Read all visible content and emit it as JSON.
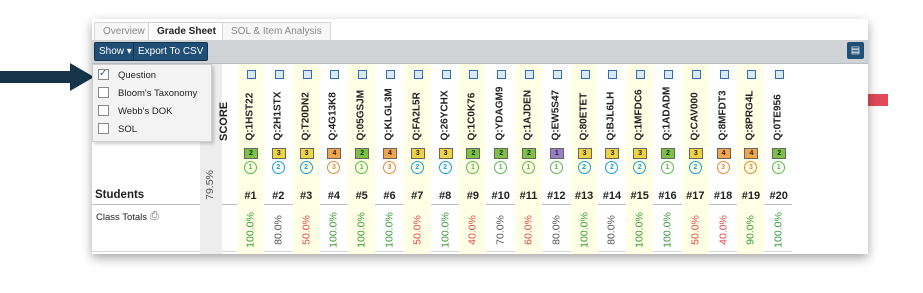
{
  "tabs": [
    "Overview",
    "Grade Sheet",
    "SOL & Item Analysis"
  ],
  "toolbar": {
    "show_label": "Show ▾",
    "export_label": "Export To CSV"
  },
  "show_menu": [
    {
      "label": "Question",
      "checked": true
    },
    {
      "label": "Bloom's Taxonomy",
      "checked": false
    },
    {
      "label": "Webb's DOK",
      "checked": false
    },
    {
      "label": "SOL",
      "checked": false
    }
  ],
  "grid": {
    "students_header": "Students",
    "score_header": "SCORE",
    "class_totals_label": "Class Totals",
    "class_score": "79.5%"
  },
  "questions": [
    {
      "id": "Q:1HST22",
      "num": "#1",
      "bloom": "2",
      "bloom_color": "#7cc242",
      "dok": "1",
      "dok_color": "#58b947",
      "pct": "100.0%",
      "pct_color": "#3a9a3a"
    },
    {
      "id": "Q:2H1STX",
      "num": "#2",
      "bloom": "3",
      "bloom_color": "#f0d343",
      "dok": "2",
      "dok_color": "#1a9ed8",
      "pct": "80.0%",
      "pct_color": "#555555"
    },
    {
      "id": "Q:T20DN2",
      "num": "#3",
      "bloom": "3",
      "bloom_color": "#f0d343",
      "dok": "2",
      "dok_color": "#1a9ed8",
      "pct": "50.0%",
      "pct_color": "#e24a4a"
    },
    {
      "id": "Q:4G13K8",
      "num": "#4",
      "bloom": "4",
      "bloom_color": "#f2a54a",
      "dok": "3",
      "dok_color": "#e38a2f",
      "pct": "100.0%",
      "pct_color": "#3a9a3a"
    },
    {
      "id": "Q:05GSJM",
      "num": "#5",
      "bloom": "2",
      "bloom_color": "#7cc242",
      "dok": "1",
      "dok_color": "#58b947",
      "pct": "100.0%",
      "pct_color": "#3a9a3a"
    },
    {
      "id": "Q:KLGL3M",
      "num": "#6",
      "bloom": "4",
      "bloom_color": "#f2a54a",
      "dok": "3",
      "dok_color": "#e38a2f",
      "pct": "100.0%",
      "pct_color": "#3a9a3a"
    },
    {
      "id": "Q:FA2L5R",
      "num": "#7",
      "bloom": "3",
      "bloom_color": "#f0d343",
      "dok": "2",
      "dok_color": "#1a9ed8",
      "pct": "50.0%",
      "pct_color": "#e24a4a"
    },
    {
      "id": "Q:26YCHX",
      "num": "#8",
      "bloom": "3",
      "bloom_color": "#f0d343",
      "dok": "2",
      "dok_color": "#1a9ed8",
      "pct": "100.0%",
      "pct_color": "#3a9a3a"
    },
    {
      "id": "Q:1C0K76",
      "num": "#9",
      "bloom": "2",
      "bloom_color": "#7cc242",
      "dok": "1",
      "dok_color": "#58b947",
      "pct": "40.0%",
      "pct_color": "#e24a4a"
    },
    {
      "id": "Q:YDAGM9",
      "num": "#10",
      "bloom": "2",
      "bloom_color": "#7cc242",
      "dok": "1",
      "dok_color": "#58b947",
      "pct": "70.0%",
      "pct_color": "#555555"
    },
    {
      "id": "Q:1AJDEN",
      "num": "#11",
      "bloom": "2",
      "bloom_color": "#7cc242",
      "dok": "1",
      "dok_color": "#58b947",
      "pct": "60.0%",
      "pct_color": "#e24a4a"
    },
    {
      "id": "Q:EW5S47",
      "num": "#12",
      "bloom": "1",
      "bloom_color": "#9a7fc8",
      "dok": "1",
      "dok_color": "#58b947",
      "pct": "80.0%",
      "pct_color": "#555555"
    },
    {
      "id": "Q:80ETET",
      "num": "#13",
      "bloom": "3",
      "bloom_color": "#f0d343",
      "dok": "2",
      "dok_color": "#1a9ed8",
      "pct": "100.0%",
      "pct_color": "#3a9a3a"
    },
    {
      "id": "Q:BJL6LH",
      "num": "#14",
      "bloom": "3",
      "bloom_color": "#f0d343",
      "dok": "2",
      "dok_color": "#1a9ed8",
      "pct": "80.0%",
      "pct_color": "#555555"
    },
    {
      "id": "Q:1MFDC6",
      "num": "#15",
      "bloom": "3",
      "bloom_color": "#f0d343",
      "dok": "2",
      "dok_color": "#1a9ed8",
      "pct": "100.0%",
      "pct_color": "#3a9a3a"
    },
    {
      "id": "Q:1ADADM",
      "num": "#16",
      "bloom": "2",
      "bloom_color": "#7cc242",
      "dok": "1",
      "dok_color": "#58b947",
      "pct": "100.0%",
      "pct_color": "#3a9a3a"
    },
    {
      "id": "Q:CAV000",
      "num": "#17",
      "bloom": "3",
      "bloom_color": "#f0d343",
      "dok": "2",
      "dok_color": "#1a9ed8",
      "pct": "50.0%",
      "pct_color": "#e24a4a"
    },
    {
      "id": "Q:8MFDT3",
      "num": "#18",
      "bloom": "4",
      "bloom_color": "#f2a54a",
      "dok": "3",
      "dok_color": "#e38a2f",
      "pct": "40.0%",
      "pct_color": "#e24a4a"
    },
    {
      "id": "Q:8PRG4L",
      "num": "#19",
      "bloom": "4",
      "bloom_color": "#f2a54a",
      "dok": "3",
      "dok_color": "#e38a2f",
      "pct": "90.0%",
      "pct_color": "#3a9a3a"
    },
    {
      "id": "Q:0TE956",
      "num": "#20",
      "bloom": "2",
      "bloom_color": "#7cc242",
      "dok": "1",
      "dok_color": "#58b947",
      "pct": "100.0%",
      "pct_color": "#3a9a3a"
    }
  ],
  "colors": {
    "left_arrow": "#15344a",
    "right_arrow": "#e04a5a",
    "button": "#1f4f77"
  }
}
